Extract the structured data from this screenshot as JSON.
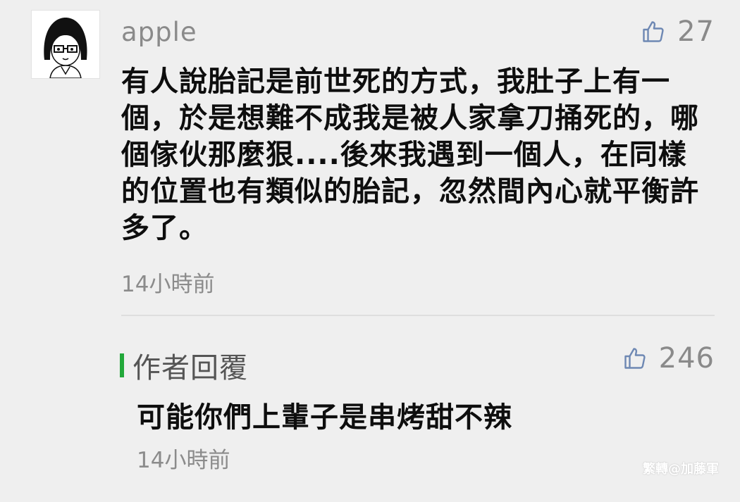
{
  "comment": {
    "avatar_icon": "cartoon-girl-avatar-icon",
    "username": "apple",
    "like_icon": "thumbs-up-icon",
    "like_count": "27",
    "text": "有人說胎記是前世死的方式，我肚子上有一個，於是想難不成我是被人家拿刀捅死的，哪個傢伙那麼狠....後來我遇到一個人，在同樣的位置也有類似的胎記，忽然間內心就平衡許多了。",
    "time": "14小時前"
  },
  "reply": {
    "label": "作者回覆",
    "accent_color": "#22a83a",
    "like_icon": "thumbs-up-icon",
    "like_count": "246",
    "text": "可能你們上輩子是串烤甜不辣",
    "time": "14小時前"
  },
  "watermark": "繁轉@加藤軍"
}
